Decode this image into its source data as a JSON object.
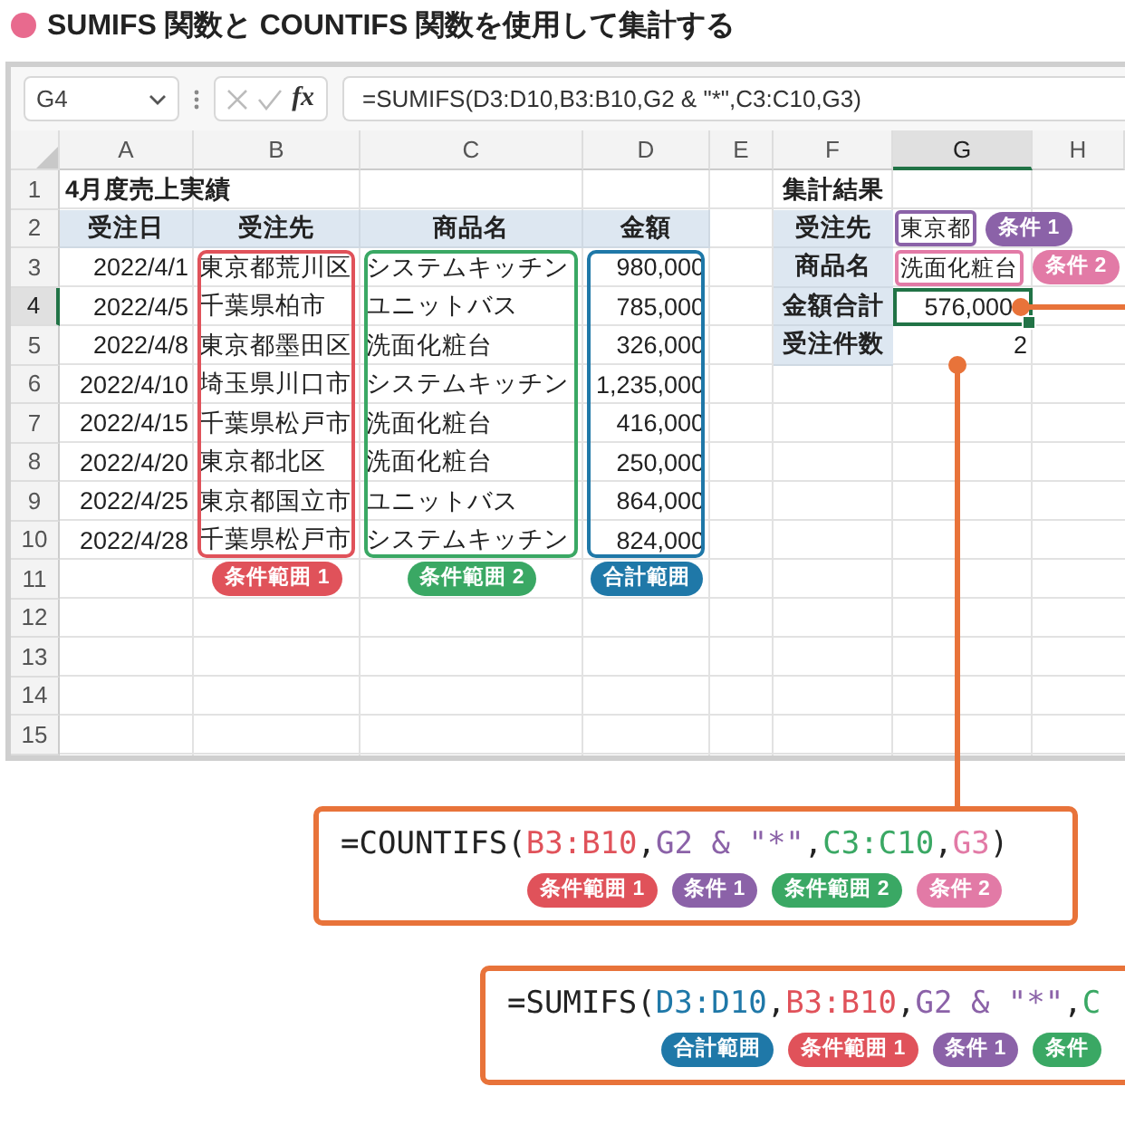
{
  "title": {
    "text": "SUMIFS 関数と COUNTIFS 関数を使用して集計する"
  },
  "formula_bar": {
    "name_box": "G4",
    "function_label": "fx",
    "formula": "=SUMIFS(D3:D10,B3:B10,G2 & \"*\",C3:C10,G3)"
  },
  "columns": [
    {
      "label": "A",
      "selected": false
    },
    {
      "label": "B",
      "selected": false
    },
    {
      "label": "C",
      "selected": false
    },
    {
      "label": "D",
      "selected": false
    },
    {
      "label": "E",
      "selected": false
    },
    {
      "label": "F",
      "selected": false
    },
    {
      "label": "G",
      "selected": true
    },
    {
      "label": "H",
      "selected": false
    }
  ],
  "row_numbers": [
    {
      "label": "1",
      "selected": false
    },
    {
      "label": "2",
      "selected": false
    },
    {
      "label": "3",
      "selected": false
    },
    {
      "label": "4",
      "selected": true
    },
    {
      "label": "5",
      "selected": false
    },
    {
      "label": "6",
      "selected": false
    },
    {
      "label": "7",
      "selected": false
    },
    {
      "label": "8",
      "selected": false
    },
    {
      "label": "9",
      "selected": false
    },
    {
      "label": "10",
      "selected": false
    },
    {
      "label": "11",
      "selected": false
    },
    {
      "label": "12",
      "selected": false
    },
    {
      "label": "13",
      "selected": false
    },
    {
      "label": "14",
      "selected": false
    },
    {
      "label": "15",
      "selected": false
    }
  ],
  "sheet_title": "4月度売上実績",
  "orders": {
    "headers": [
      "受注日",
      "受注先",
      "商品名",
      "金額"
    ],
    "rows": [
      {
        "date": "2022/4/1",
        "customer": "東京都荒川区",
        "product": "システムキッチン",
        "amount": "980,000"
      },
      {
        "date": "2022/4/5",
        "customer": "千葉県柏市",
        "product": "ユニットバス",
        "amount": "785,000"
      },
      {
        "date": "2022/4/8",
        "customer": "東京都墨田区",
        "product": "洗面化粧台",
        "amount": "326,000"
      },
      {
        "date": "2022/4/10",
        "customer": "埼玉県川口市",
        "product": "システムキッチン",
        "amount": "1,235,000"
      },
      {
        "date": "2022/4/15",
        "customer": "千葉県松戸市",
        "product": "洗面化粧台",
        "amount": "416,000"
      },
      {
        "date": "2022/4/20",
        "customer": "東京都北区",
        "product": "洗面化粧台",
        "amount": "250,000"
      },
      {
        "date": "2022/4/25",
        "customer": "東京都国立市",
        "product": "ユニットバス",
        "amount": "864,000"
      },
      {
        "date": "2022/4/28",
        "customer": "千葉県松戸市",
        "product": "システムキッチン",
        "amount": "824,000"
      }
    ]
  },
  "range_labels": [
    {
      "text": "条件範囲 1",
      "color": "#e0525a"
    },
    {
      "text": "条件範囲 2",
      "color": "#3aa864"
    },
    {
      "text": "合計範囲",
      "color": "#1f78a8"
    }
  ],
  "summary": {
    "title": "集計結果",
    "items": [
      {
        "label": "受注先",
        "value": "東京都",
        "color": "#8b62a8",
        "badge": "条件 1",
        "selected": false
      },
      {
        "label": "商品名",
        "value": "洗面化粧台",
        "color": "#e27aa6",
        "badge": "条件 2",
        "selected": false
      },
      {
        "label": "金額合計",
        "value": "576,000",
        "selected": true
      },
      {
        "label": "受注件数",
        "value": "2",
        "selected": false
      }
    ]
  },
  "formula_callouts": [
    {
      "parts": [
        {
          "text": "=COUNTIFS(",
          "color": "#222222"
        },
        {
          "text": "B3:B10",
          "suffix": ",",
          "color": "#e0525a"
        },
        {
          "text": "G2 & \"*\"",
          "suffix": ",",
          "color": "#8b62a8"
        },
        {
          "text": "C3:C10",
          "suffix": ",",
          "color": "#3aa864"
        },
        {
          "text": "G3",
          "color": "#e27aa6"
        },
        {
          "text": ")",
          "color": "#222222"
        }
      ],
      "badges": [
        {
          "text": "条件範囲 1",
          "color": "#e0525a"
        },
        {
          "text": "条件 1",
          "color": "#8b62a8"
        },
        {
          "text": "条件範囲 2",
          "color": "#3aa864"
        },
        {
          "text": "条件 2",
          "color": "#e27aa6"
        }
      ]
    },
    {
      "parts": [
        {
          "text": "=SUMIFS(",
          "color": "#222222"
        },
        {
          "text": "D3:D10",
          "suffix": ",",
          "color": "#1f78a8"
        },
        {
          "text": "B3:B10",
          "suffix": ",",
          "color": "#e0525a"
        },
        {
          "text": "G2 & \"*\"",
          "suffix": ",",
          "color": "#8b62a8"
        },
        {
          "text": "C",
          "color": "#3aa864"
        }
      ],
      "badges": [
        {
          "text": "合計範囲",
          "color": "#1f78a8"
        },
        {
          "text": "条件範囲 1",
          "color": "#e0525a"
        },
        {
          "text": "条件 1",
          "color": "#8b62a8"
        },
        {
          "text": "条件",
          "color": "#3aa864"
        }
      ]
    }
  ]
}
